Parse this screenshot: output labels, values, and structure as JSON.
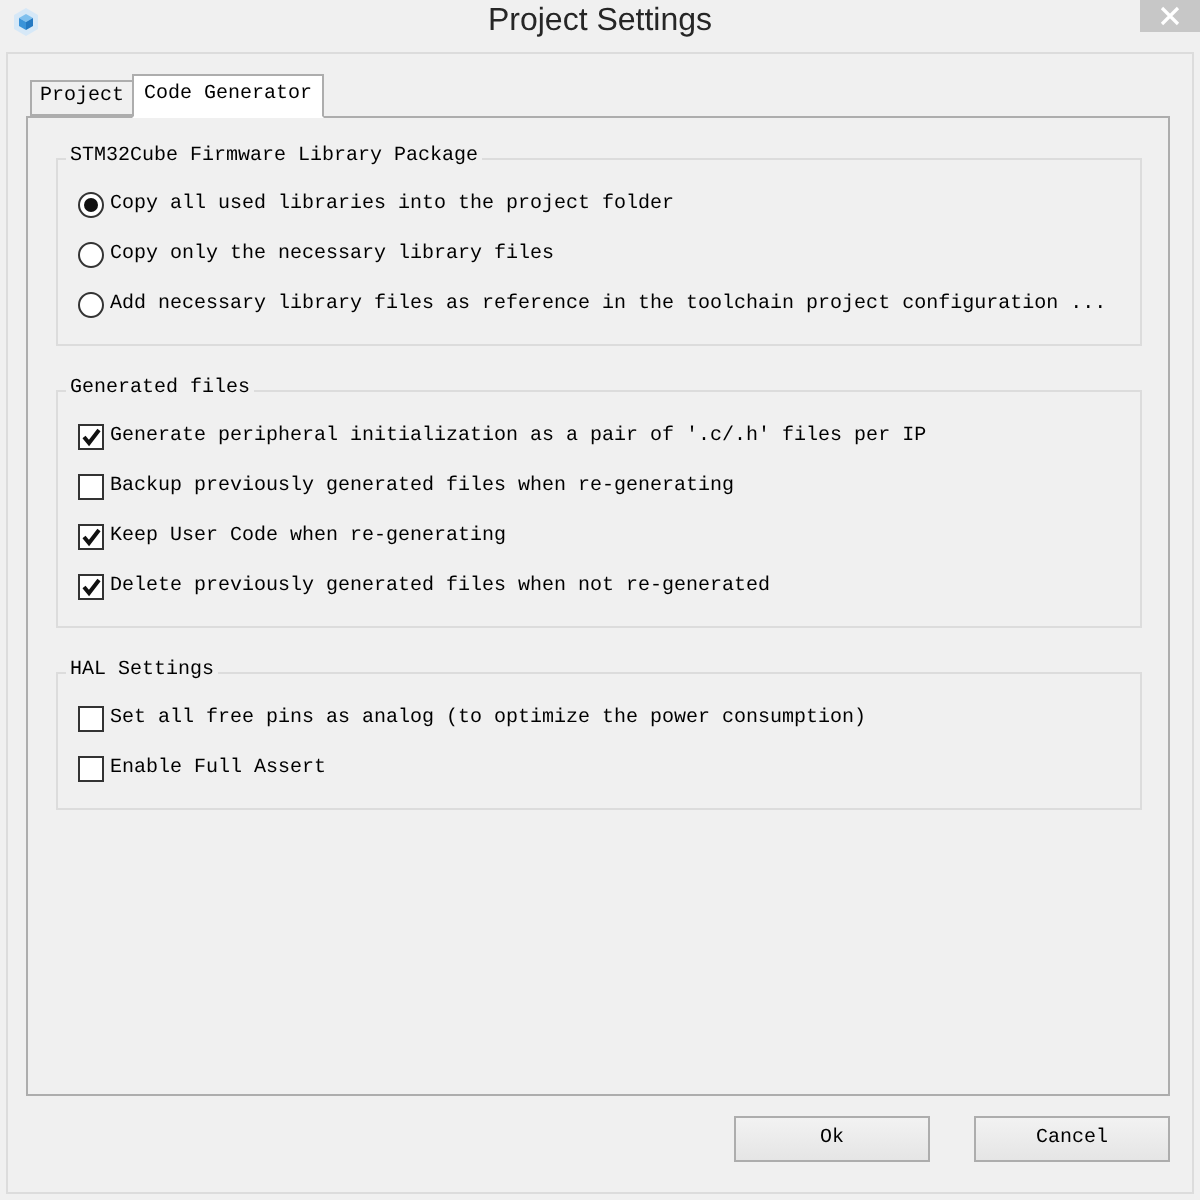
{
  "window": {
    "title": "Project Settings"
  },
  "tabs": [
    {
      "label": "Project",
      "selected": false
    },
    {
      "label": "Code Generator",
      "selected": true
    }
  ],
  "groups": [
    {
      "title": "STM32Cube Firmware Library Package",
      "options": [
        {
          "kind": "radio",
          "label": "Copy all used libraries into the project folder",
          "selected": true
        },
        {
          "kind": "radio",
          "label": "Copy only the necessary library files",
          "selected": false
        },
        {
          "kind": "radio",
          "label": "Add necessary library files as reference in the toolchain project configuration ...",
          "selected": false
        }
      ]
    },
    {
      "title": "Generated files",
      "options": [
        {
          "kind": "checkbox",
          "label": "Generate peripheral initialization as a pair of '.c/.h' files per IP",
          "checked": true
        },
        {
          "kind": "checkbox",
          "label": "Backup previously generated files when re-generating",
          "checked": false
        },
        {
          "kind": "checkbox",
          "label": "Keep User Code when re-generating",
          "checked": true
        },
        {
          "kind": "checkbox",
          "label": "Delete previously generated files when not re-generated",
          "checked": true
        }
      ]
    },
    {
      "title": "HAL Settings",
      "options": [
        {
          "kind": "checkbox",
          "label": "Set all free pins as analog (to optimize the power consumption)",
          "checked": false
        },
        {
          "kind": "checkbox",
          "label": "Enable Full Assert",
          "checked": false
        }
      ]
    }
  ],
  "buttons": [
    "Ok",
    "Cancel"
  ]
}
